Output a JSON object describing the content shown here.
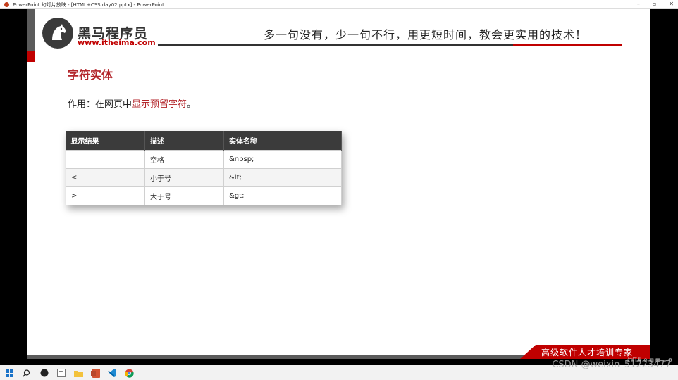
{
  "window": {
    "title": "PowerPoint 幻灯片放映 - [HTML+CSS day02.pptx] - PowerPoint",
    "controls": [
      "–",
      "▫",
      "✕"
    ]
  },
  "logo": {
    "name": "黑马程序员",
    "url": "www.itheima.com"
  },
  "slogan": "多一句没有，少一句不行，用更短时间，教会更实用的技术！",
  "slide": {
    "heading": "字符实体",
    "usage_prefix": "作用：在网页中",
    "usage_highlight": "显示预留字符",
    "usage_suffix": "。",
    "table": {
      "headers": [
        "显示结果",
        "描述",
        "实体名称"
      ],
      "rows": [
        [
          "",
          "空格",
          "&nbsp;"
        ],
        [
          "<",
          "小于号",
          "&lt;"
        ],
        [
          ">",
          "大于号",
          "&gt;"
        ]
      ]
    },
    "footer_badge": "高级软件人才培训专家"
  },
  "statusbar": {
    "right": "幻灯片 ⊙ ▤ ▦ ▭ ⚙"
  },
  "watermark": "CSDN @weixin_51223477",
  "taskbar": {
    "items": [
      "windows-start-icon",
      "search-icon",
      "github-icon",
      "typora-icon",
      "folder-icon",
      "powerpoint-icon",
      "vscode-icon",
      "chrome-icon"
    ]
  }
}
